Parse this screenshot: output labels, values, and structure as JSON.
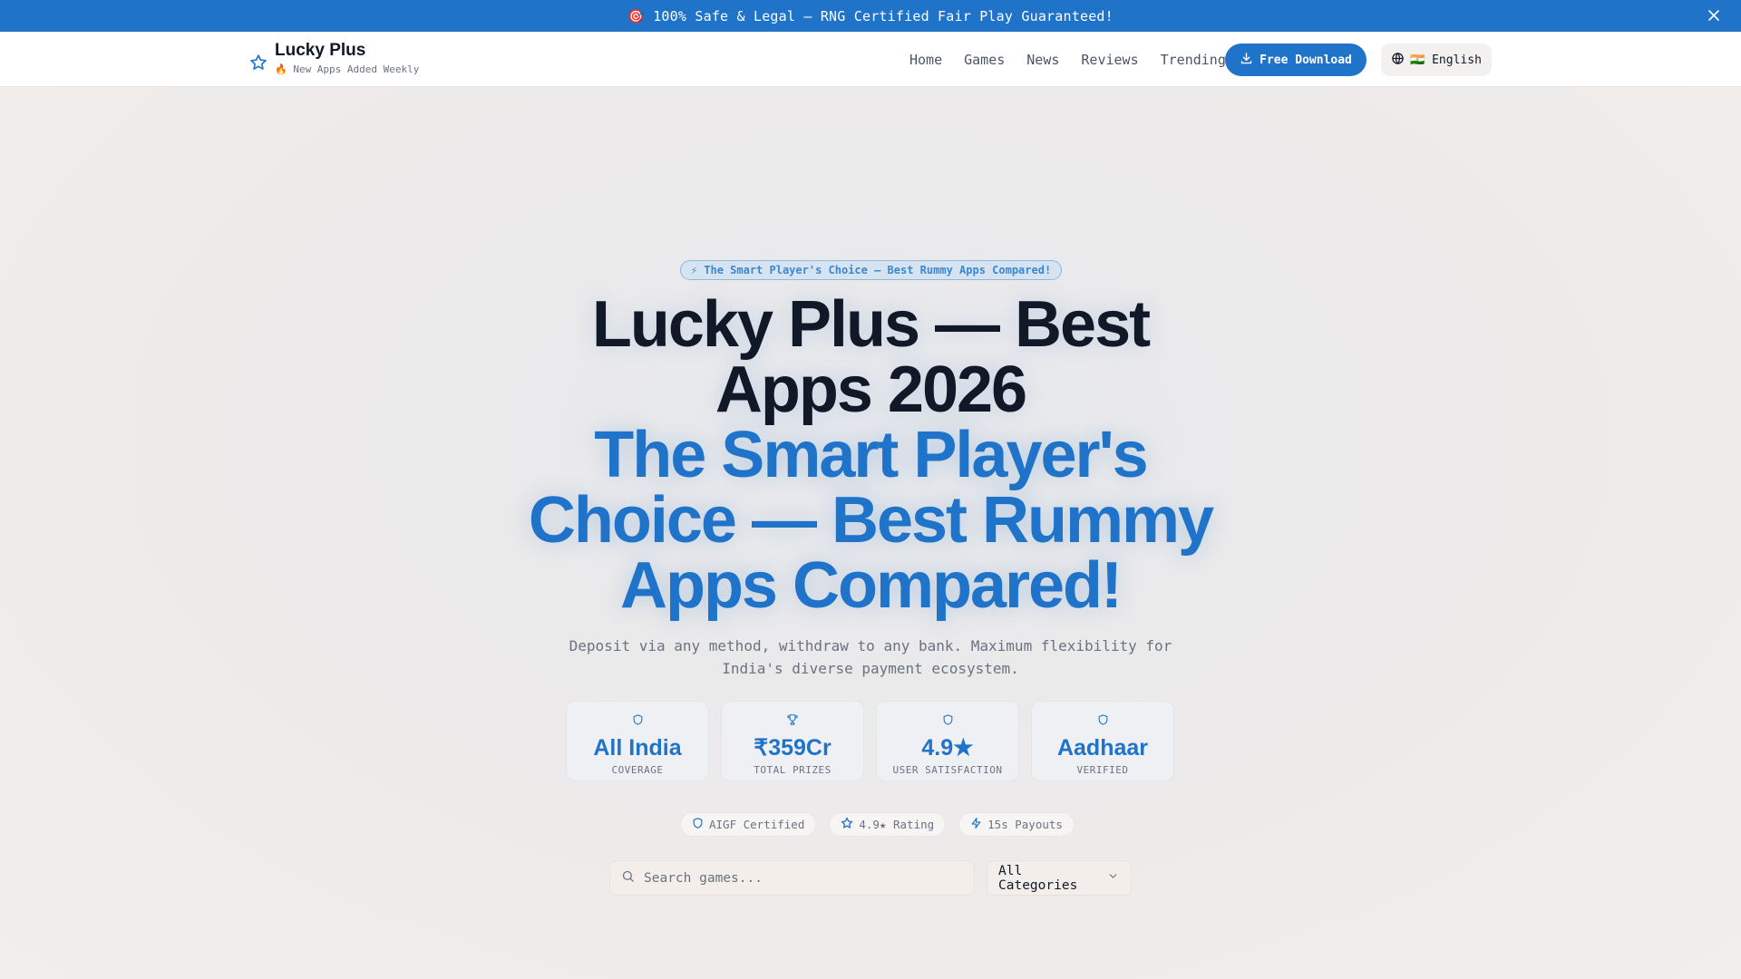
{
  "topbar": {
    "message": "🎯 100% Safe & Legal — RNG Certified Fair Play Guaranteed!",
    "close_icon": "close-icon"
  },
  "header": {
    "brand_name": "Lucky Plus",
    "brand_tagline": "🔥 New Apps Added Weekly",
    "nav": [
      "Home",
      "Games",
      "News",
      "Reviews",
      "Trending"
    ],
    "download_label": "Free Download",
    "language_label": "🇮🇳 English"
  },
  "hero": {
    "pill": "⚡ The Smart Player's Choice — Best Rummy Apps Compared!",
    "title_line1": "Lucky Plus — Best Apps 2026",
    "title_line2": "The Smart Player's Choice — Best Rummy Apps Compared!",
    "subtitle": "Deposit via any method, withdraw to any bank. Maximum flexibility for India's diverse payment ecosystem."
  },
  "stats": [
    {
      "icon": "shield-icon",
      "value": "All India",
      "label": "COVERAGE"
    },
    {
      "icon": "trophy-icon",
      "value": "₹359Cr",
      "label": "TOTAL PRIZES"
    },
    {
      "icon": "shield-icon",
      "value": "4.9★",
      "label": "USER SATISFACTION"
    },
    {
      "icon": "shield-icon",
      "value": "Aadhaar",
      "label": "VERIFIED"
    }
  ],
  "badges": [
    {
      "icon": "shield-icon",
      "label": "AIGF Certified"
    },
    {
      "icon": "star-icon",
      "label": "4.9★ Rating"
    },
    {
      "icon": "zap-icon",
      "label": "15s Payouts"
    }
  ],
  "search": {
    "placeholder": "Search games...",
    "value": ""
  },
  "category_select": {
    "selected": "All Categories"
  },
  "colors": {
    "primary": "#1f73c9",
    "heading": "#111827",
    "muted": "#6b7280"
  }
}
